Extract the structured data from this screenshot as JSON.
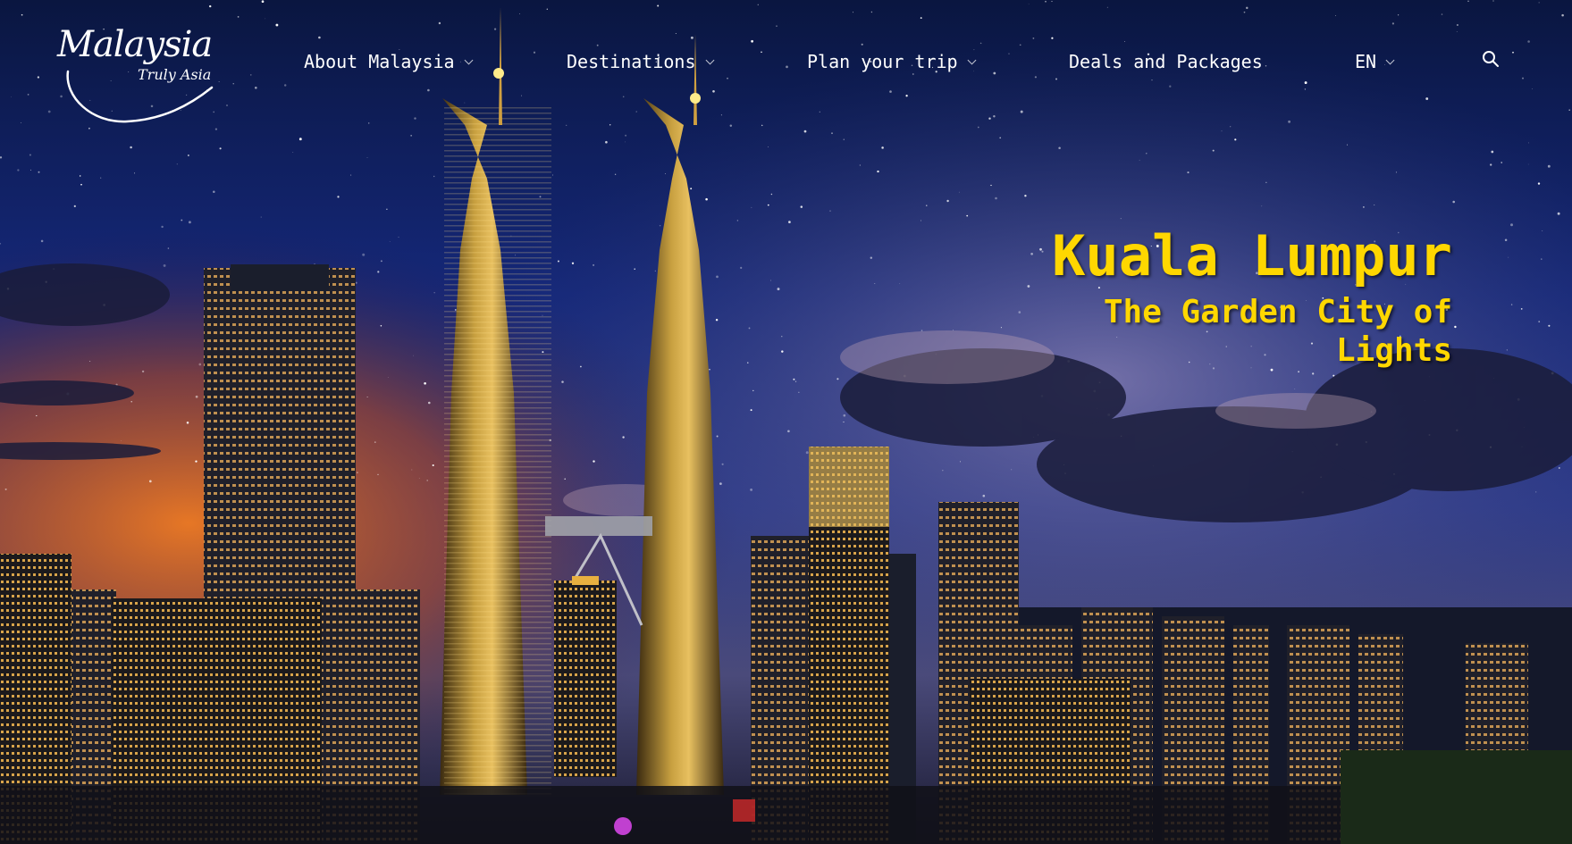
{
  "brand": {
    "logo_text": "Malaysia",
    "logo_tagline": "Truly Asia"
  },
  "nav": {
    "items": [
      {
        "label": "About Malaysia",
        "has_dropdown": true
      },
      {
        "label": "Destinations",
        "has_dropdown": true
      },
      {
        "label": "Plan your trip",
        "has_dropdown": true
      },
      {
        "label": "Deals and Packages",
        "has_dropdown": false
      }
    ],
    "language": "EN",
    "search_icon": "search-icon"
  },
  "hero": {
    "title": "Kuala Lumpur",
    "subtitle": "The Garden City of Lights",
    "text_color": "#ffd700",
    "background_description": "night skyline image"
  },
  "colors": {
    "nav_text": "#ffffff",
    "accent": "#ffd700"
  }
}
